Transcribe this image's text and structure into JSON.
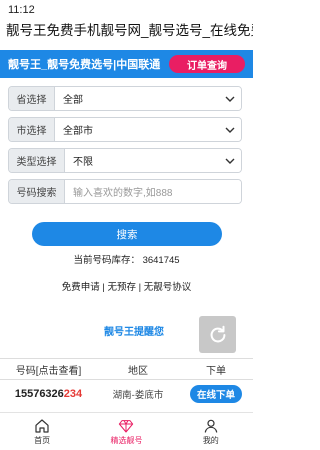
{
  "status_bar": {
    "time": "11:12"
  },
  "page_heading": "靓号王免费手机靓号网_靓号选号_在线免费选…",
  "header": {
    "site_title": "靓号王_靓号免费选号|中国联通",
    "order_query": "订单查询"
  },
  "form": {
    "province": {
      "label": "省选择",
      "value": "全部"
    },
    "city": {
      "label": "市选择",
      "value": "全部市"
    },
    "type": {
      "label": "类型选择",
      "value": "不限"
    },
    "number": {
      "label": "号码搜索",
      "placeholder": "输入喜欢的数字,如888"
    },
    "search_button": "搜索"
  },
  "stock_text": "当前号码库存： 3641745",
  "links": {
    "free_apply": "免费申请",
    "sep1": " | ",
    "no_prestore": "无预存",
    "sep2": " | ",
    "agreement": "无靓号协议"
  },
  "remind_link": "靓号王提醒您",
  "table": {
    "headers": [
      "号码[点击查看]",
      "地区",
      "下单"
    ],
    "rows": [
      {
        "number_head": "15576326",
        "number_tail": "234",
        "region": "湖南-娄底市",
        "action": "在线下单"
      }
    ]
  },
  "bottom_nav": [
    {
      "label": "首页",
      "icon": "home-icon"
    },
    {
      "label": "精选靓号",
      "icon": "diamond-icon"
    },
    {
      "label": "我的",
      "icon": "user-icon"
    }
  ],
  "colors": {
    "accent_blue": "#1e88e5",
    "accent_pink": "#e91e63",
    "number_tail": "#e53935"
  }
}
